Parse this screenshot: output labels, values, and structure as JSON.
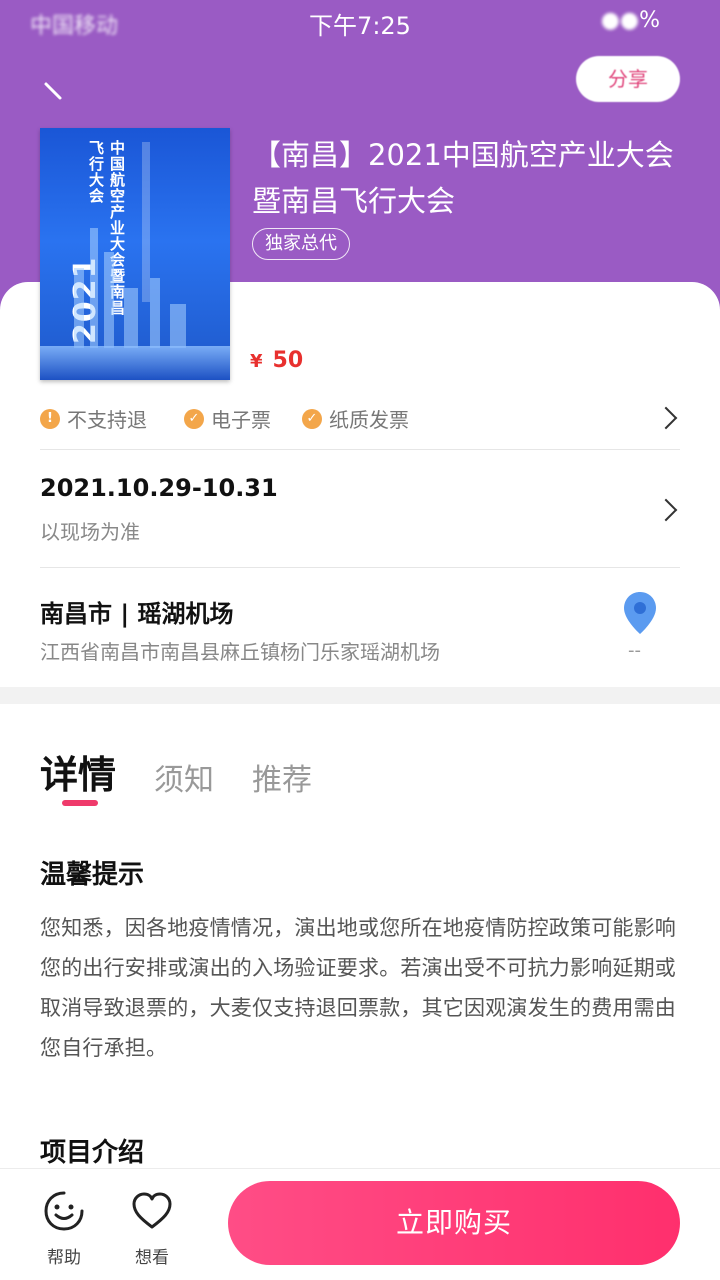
{
  "status_bar": {
    "carrier": "中国移动",
    "time": "下午7:25",
    "battery": "%"
  },
  "header": {
    "share_label": "分享"
  },
  "event": {
    "title": "【南昌】2021中国航空产业大会暨南昌飞行大会",
    "tag": "独家总代",
    "price_currency": "¥",
    "price": "50",
    "poster_year": "2021",
    "poster_title": "中国航空产业大会暨南昌飞行大会"
  },
  "services": [
    {
      "label": "不支持退",
      "icon": "exclamation-icon"
    },
    {
      "label": "电子票",
      "icon": "check-icon"
    },
    {
      "label": "纸质发票",
      "icon": "check-icon"
    }
  ],
  "schedule": {
    "date": "2021.10.29-10.31",
    "note": "以现场为准"
  },
  "location": {
    "venue": "南昌市 | 瑶湖机场",
    "address": "江西省南昌市南昌县麻丘镇杨门乐家瑶湖机场",
    "distance": "--"
  },
  "tabs": [
    {
      "label": "详情"
    },
    {
      "label": "须知"
    },
    {
      "label": "推荐"
    }
  ],
  "detail": {
    "notice_title": "温馨提示",
    "notice_body": "您知悉，因各地疫情情况，演出地或您所在地疫情防控政策可能影响您的出行安排或演出的入场验证要求。若演出受不可抗力影响延期或取消导致退票的，大麦仅支持退回票款，其它因观演发生的费用需由您自行承担。",
    "intro_title": "项目介绍"
  },
  "bottom_bar": {
    "help_label": "帮助",
    "want_label": "想看",
    "buy_label": "立即购买"
  },
  "colors": {
    "header_purple": "#9a5bc4",
    "accent_pink": "#ff2f6d",
    "price_red": "#e8302e",
    "service_orange": "#f3a64a"
  }
}
